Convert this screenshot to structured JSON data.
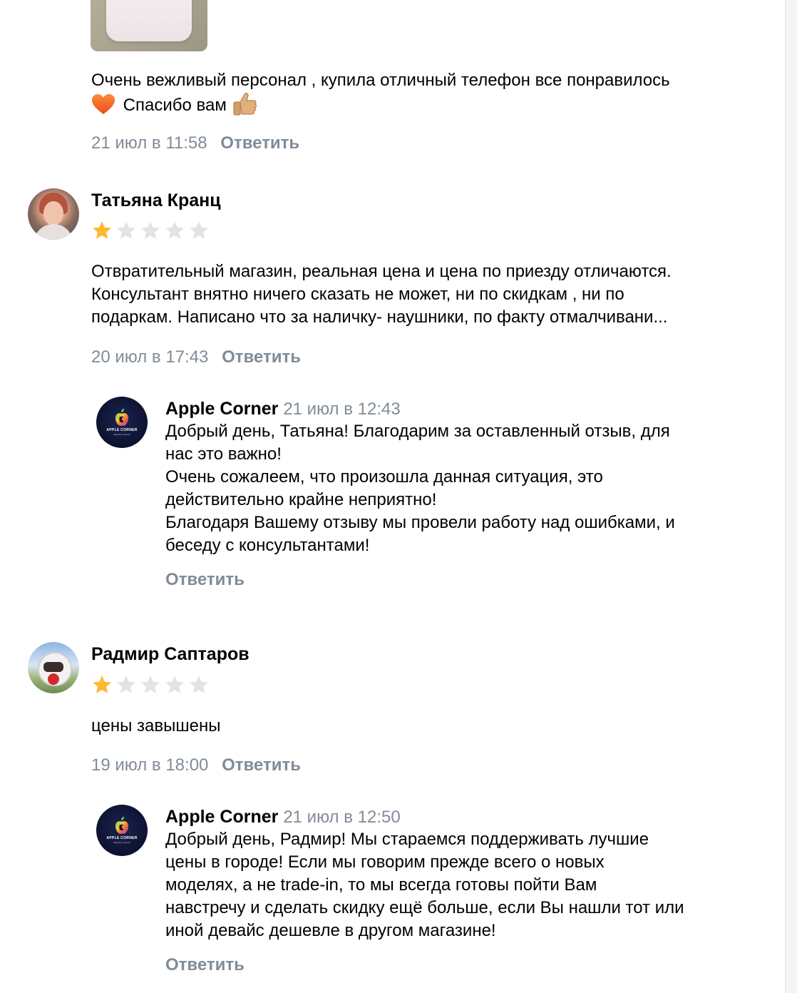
{
  "comments": [
    {
      "text_line1": "Очень вежливый персонал , купила отличный телефон все понравилось",
      "text_line2": "Спасибо вам",
      "emoji_heart": "heart-icon",
      "emoji_thumb": "thumbs-up-icon",
      "date": "21 июл в 11:58",
      "reply_label": "Ответить"
    },
    {
      "author": "Татьяна Кранц",
      "rating": 1,
      "rating_max": 5,
      "text_lines": [
        "Отвратительный магазин, реальная цена и цена по приезду отличаются.",
        "Консультант внятно ничего сказать не может, ни по скидкам , ни по",
        "подаркам. Написано что за наличку- наушники, по факту отмалчивани..."
      ],
      "date": "20 июл в 17:43",
      "reply_label": "Ответить",
      "store_reply": {
        "author": "Apple Corner",
        "date": "21 июл в 12:43",
        "text_lines": [
          "Добрый день, Татьяна! Благодарим за оставленный отзыв, для",
          "нас это важно!",
          "Очень сожалеем, что произошла данная ситуация, это",
          "действительно крайне неприятно!",
          "Благодаря Вашему отзыву мы провели работу над ошибками, и",
          "беседу с консультантами!"
        ],
        "reply_label": "Ответить"
      }
    },
    {
      "author": "Радмир Саптаров",
      "rating": 1,
      "rating_max": 5,
      "text_lines": [
        "цены завышены"
      ],
      "date": "19 июл в 18:00",
      "reply_label": "Ответить",
      "store_reply": {
        "author": "Apple Corner",
        "date": "21 июл в 12:50",
        "text_lines": [
          "Добрый день, Радмир! Мы стараемся поддерживать лучшие",
          "цены в городе! Если мы говорим прежде всего о новых",
          "моделях, а не trade-in, то мы всегда готовы пойти Вам",
          "навстречу и сделать скидку ещё больше, если Вы нашли тот или",
          "иной девайс дешевле в другом магазине!"
        ],
        "reply_label": "Ответить"
      }
    }
  ],
  "store_logo": {
    "brand": "APPLE CORNER",
    "sub": "Магазин техники"
  },
  "colors": {
    "meta": "#818c99",
    "star_active": "#ffb833",
    "star_inactive": "#e1e3e6"
  }
}
